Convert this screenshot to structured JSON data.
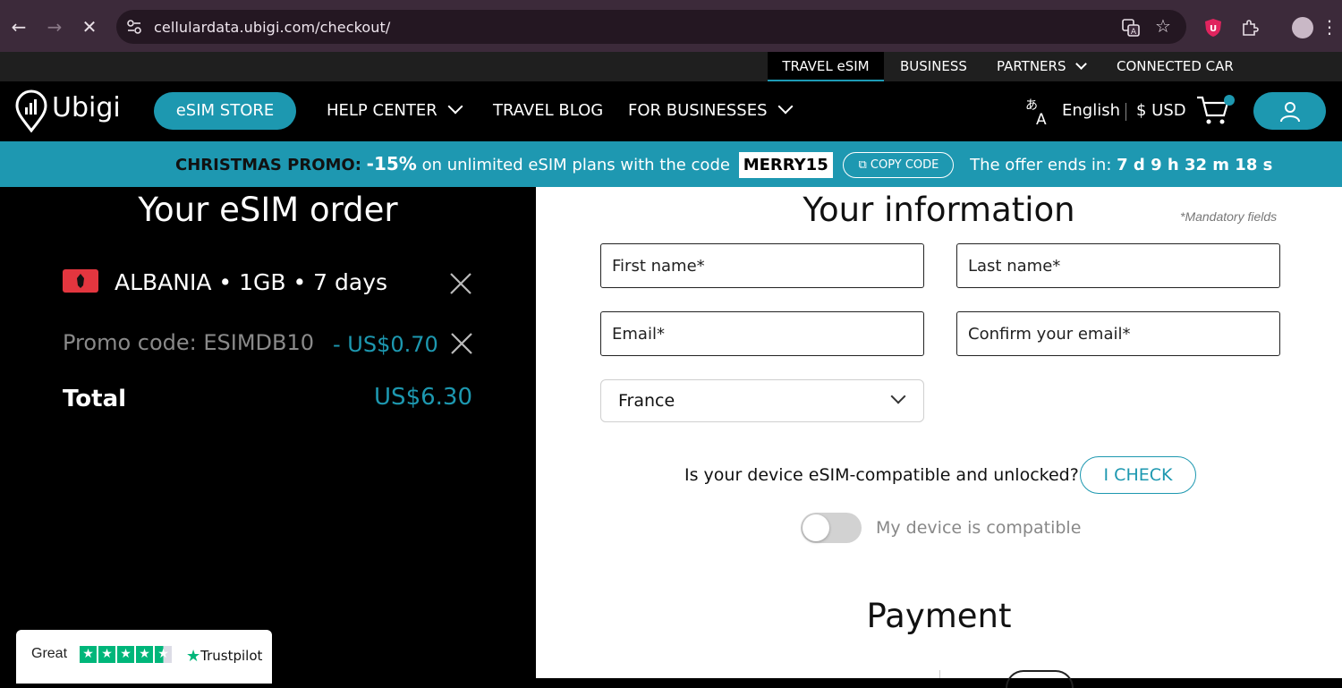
{
  "browser": {
    "url": "cellulardata.ubigi.com/checkout/"
  },
  "topnav": {
    "items": [
      "TRAVEL eSIM",
      "BUSINESS",
      "PARTNERS",
      "CONNECTED CAR"
    ]
  },
  "mainnav": {
    "logo": "Ubigi",
    "store": "eSIM STORE",
    "help": "HELP CENTER",
    "blog": "TRAVEL BLOG",
    "business": "FOR BUSINESSES",
    "language": "English",
    "currency": "$ USD"
  },
  "promo": {
    "label": "CHRISTMAS PROMO:",
    "discount": "-15%",
    "text": "on unlimited eSIM plans with the code",
    "code": "MERRY15",
    "copy": "COPY CODE",
    "ends_text": "The offer ends in:",
    "countdown": "7 d 9 h 32 m 18 s"
  },
  "order": {
    "title": "Your eSIM order",
    "item": "ALBANIA • 1GB • 7 days",
    "promo_code": "Promo code: ESIMDB10",
    "promo_discount": "- US$0.70",
    "total_label": "Total",
    "total_value": "US$6.30"
  },
  "trustpilot": {
    "rating_word": "Great",
    "brand": "Trustpilot"
  },
  "info": {
    "title": "Your information",
    "mandatory": "*Mandatory fields",
    "first_name": "First name*",
    "last_name": "Last name*",
    "email": "Email*",
    "confirm_email": "Confirm your email*",
    "country": "France",
    "compat_question": "Is your device eSIM-compatible and unlocked?",
    "check_button": "I CHECK",
    "compat_toggle_label": "My device is compatible",
    "payment_title": "Payment"
  },
  "colors": {
    "accent": "#1d98b0",
    "trustpilot_green": "#00b67a"
  }
}
